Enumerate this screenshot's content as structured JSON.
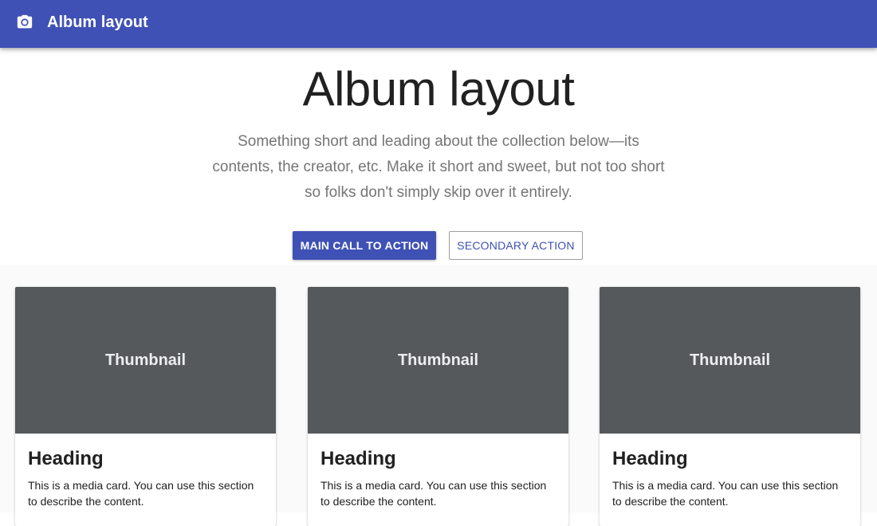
{
  "appbar": {
    "icon": "camera-icon",
    "title": "Album layout",
    "color": "#3f51b5"
  },
  "hero": {
    "title": "Album layout",
    "text": "Something short and leading about the collection below—its contents, the creator, etc. Make it short and sweet, but not too short so folks don't simply skip over it entirely.",
    "primary_button": "MAIN CALL TO ACTION",
    "secondary_button": "SECONDARY ACTION"
  },
  "cards": [
    {
      "thumbnail": "Thumbnail",
      "heading": "Heading",
      "text": "This is a media card. You can use this section to describe the content."
    },
    {
      "thumbnail": "Thumbnail",
      "heading": "Heading",
      "text": "This is a media card. You can use this section to describe the content."
    },
    {
      "thumbnail": "Thumbnail",
      "heading": "Heading",
      "text": "This is a media card. You can use this section to describe the content."
    }
  ]
}
